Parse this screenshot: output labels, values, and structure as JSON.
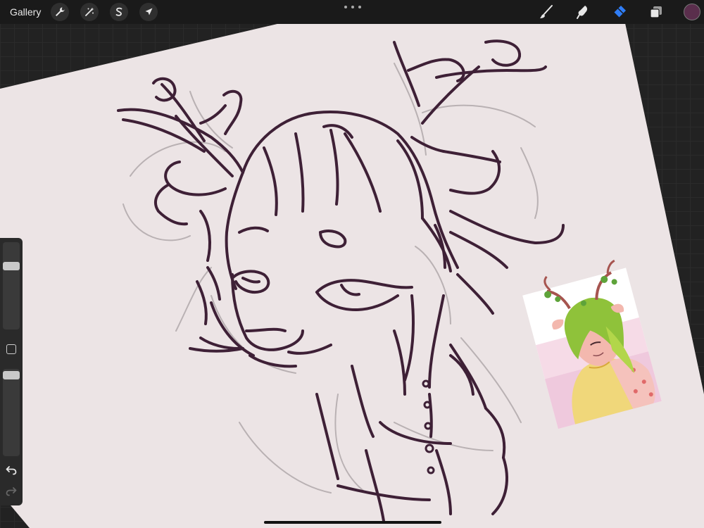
{
  "app": {
    "gallery_label": "Gallery"
  },
  "toolbar": {
    "left_tools": [
      "actions-icon",
      "adjustments-icon",
      "selection-icon",
      "transform-icon"
    ],
    "right_tools": [
      "brush-icon",
      "smudge-icon",
      "eraser-icon",
      "layers-icon"
    ],
    "active_tool": "eraser-icon",
    "accent_color": "#2f7df6",
    "current_color": "#5a2e4c"
  },
  "canvas": {
    "paper_color": "#ece4e5",
    "line_color": "#3e2036",
    "sketch_color": "#b9b1b3"
  },
  "sidebar": {
    "brush_size_level": 0.28,
    "opacity_level": 0.05
  }
}
